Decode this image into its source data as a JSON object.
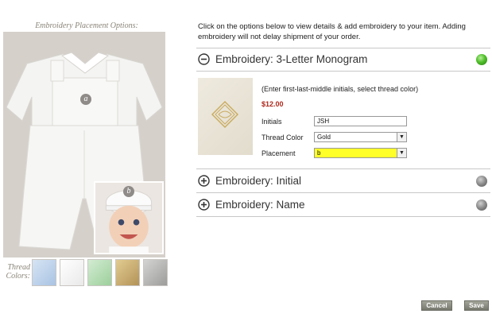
{
  "left": {
    "title": "Embroidery Placement Options:",
    "markers": [
      {
        "label": "a"
      },
      {
        "label": "b"
      }
    ],
    "thread_label": "Thread Colors:",
    "swatches": [
      {
        "name": "light-blue",
        "color": "#b9d0ea"
      },
      {
        "name": "white",
        "color": "#f7f7f7"
      },
      {
        "name": "mint-green",
        "color": "#b7dcb6"
      },
      {
        "name": "gold",
        "color": "#cbb076"
      },
      {
        "name": "silver",
        "color": "#b8b8b6"
      }
    ]
  },
  "intro_text": "Click on the options below to view details & add embroidery to your item. Adding embroidery will not delay shipment of your order.",
  "sections": [
    {
      "title": "Embroidery: 3-Letter Monogram",
      "expanded": true,
      "selected": true
    },
    {
      "title": "Embroidery: Initial",
      "expanded": false,
      "selected": false
    },
    {
      "title": "Embroidery: Name",
      "expanded": false,
      "selected": false
    }
  ],
  "monogram": {
    "instructions": "(Enter first-last-middle initials, select thread color)",
    "price": "$12.00",
    "initials_label": "Initials",
    "initials_value": "JSH",
    "thread_color_label": "Thread Color",
    "thread_color_value": "Gold",
    "placement_label": "Placement",
    "placement_value": "b"
  },
  "buttons": {
    "cancel": "Cancel",
    "save": "Save"
  },
  "colors": {
    "accent_green": "#4fbf2a",
    "placement_highlight": "#ffff2a",
    "price_red": "#b0281c"
  }
}
